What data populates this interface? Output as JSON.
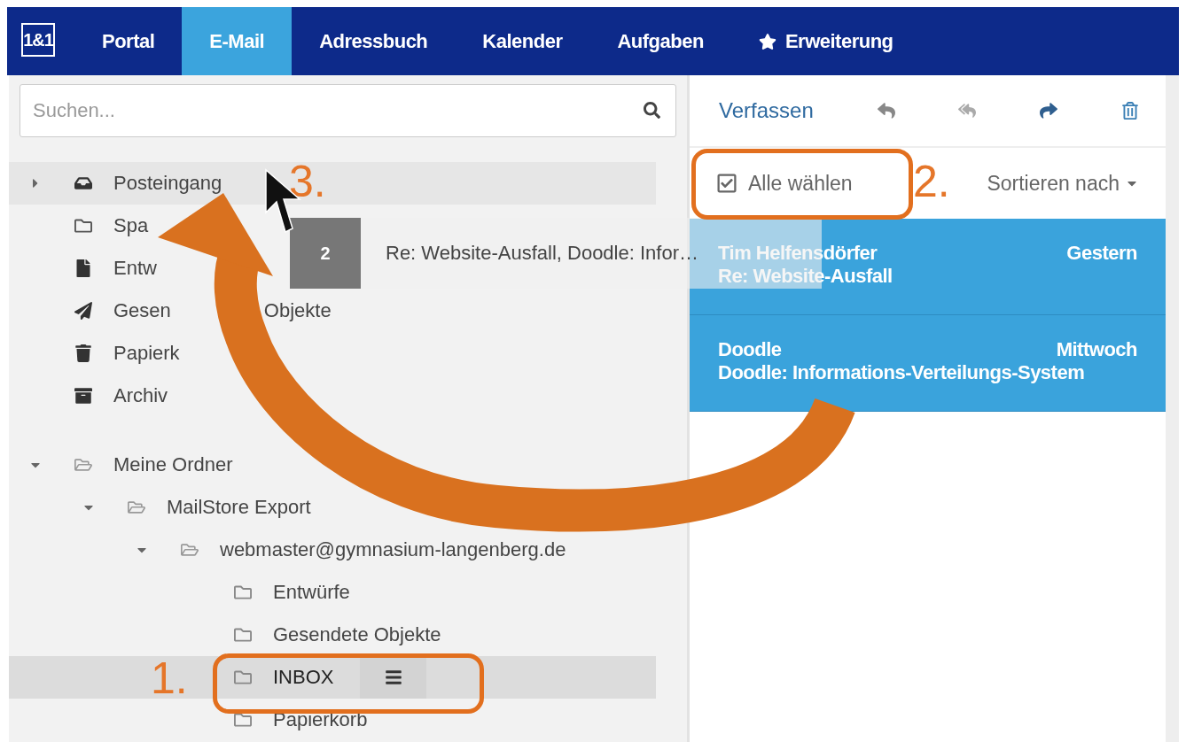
{
  "nav": {
    "logo": "1&1",
    "tabs": [
      {
        "label": "Portal",
        "selected": false
      },
      {
        "label": "E-Mail",
        "selected": true
      },
      {
        "label": "Adressbuch",
        "selected": false
      },
      {
        "label": "Kalender",
        "selected": false
      },
      {
        "label": "Aufgaben",
        "selected": false
      },
      {
        "label": "Erweiterung",
        "selected": false
      }
    ]
  },
  "search": {
    "placeholder": "Suchen..."
  },
  "folders": [
    {
      "label": "Posteingang",
      "expanded": false,
      "hovered": true,
      "selected": false
    },
    {
      "label": "Spa",
      "hovered": false,
      "selected": false
    },
    {
      "label": "Entw",
      "hovered": false,
      "selected": false
    },
    {
      "label_parts": [
        "Gesen",
        "Objekte"
      ],
      "hovered": false,
      "selected": false
    },
    {
      "label": "Papierk",
      "hovered": false,
      "selected": false
    },
    {
      "label": "Archiv",
      "hovered": false,
      "selected": false
    }
  ],
  "my_folders": [
    {
      "label": "Meine Ordner",
      "expanded": true,
      "selected": false,
      "children": [
        {
          "label": "MailStore Export",
          "expanded": true,
          "selected": false,
          "children": [
            {
              "label": "webmaster@gymnasium-langenberg.de",
              "expanded": true,
              "selected": false,
              "children": [
                {
                  "label": "Entwürfe",
                  "selected": false
                },
                {
                  "label": "Gesendete Objekte",
                  "selected": false
                },
                {
                  "label": "INBOX",
                  "selected": true
                },
                {
                  "label": "Papierkorb",
                  "selected": false
                }
              ]
            }
          ]
        }
      ]
    }
  ],
  "toolbar": {
    "compose": "Verfassen"
  },
  "select_all": {
    "label": "Alle wählen",
    "checked": true
  },
  "sort": {
    "label": "Sortieren nach"
  },
  "messages": [
    {
      "sender": "Tim Helfensdörfer",
      "date": "Gestern",
      "subject": "Re: Website-Ausfall",
      "selected": true
    },
    {
      "sender": "Doodle",
      "date": "Mittwoch",
      "subject": "Doodle: Informations-Verteilungs-System",
      "selected": true
    }
  ],
  "drag_ghost": {
    "count": "2",
    "text": "Re: Website-Ausfall, Doodle: Infor…"
  },
  "annotations": [
    {
      "label": "1."
    },
    {
      "label": "2."
    },
    {
      "label": "3."
    }
  ]
}
